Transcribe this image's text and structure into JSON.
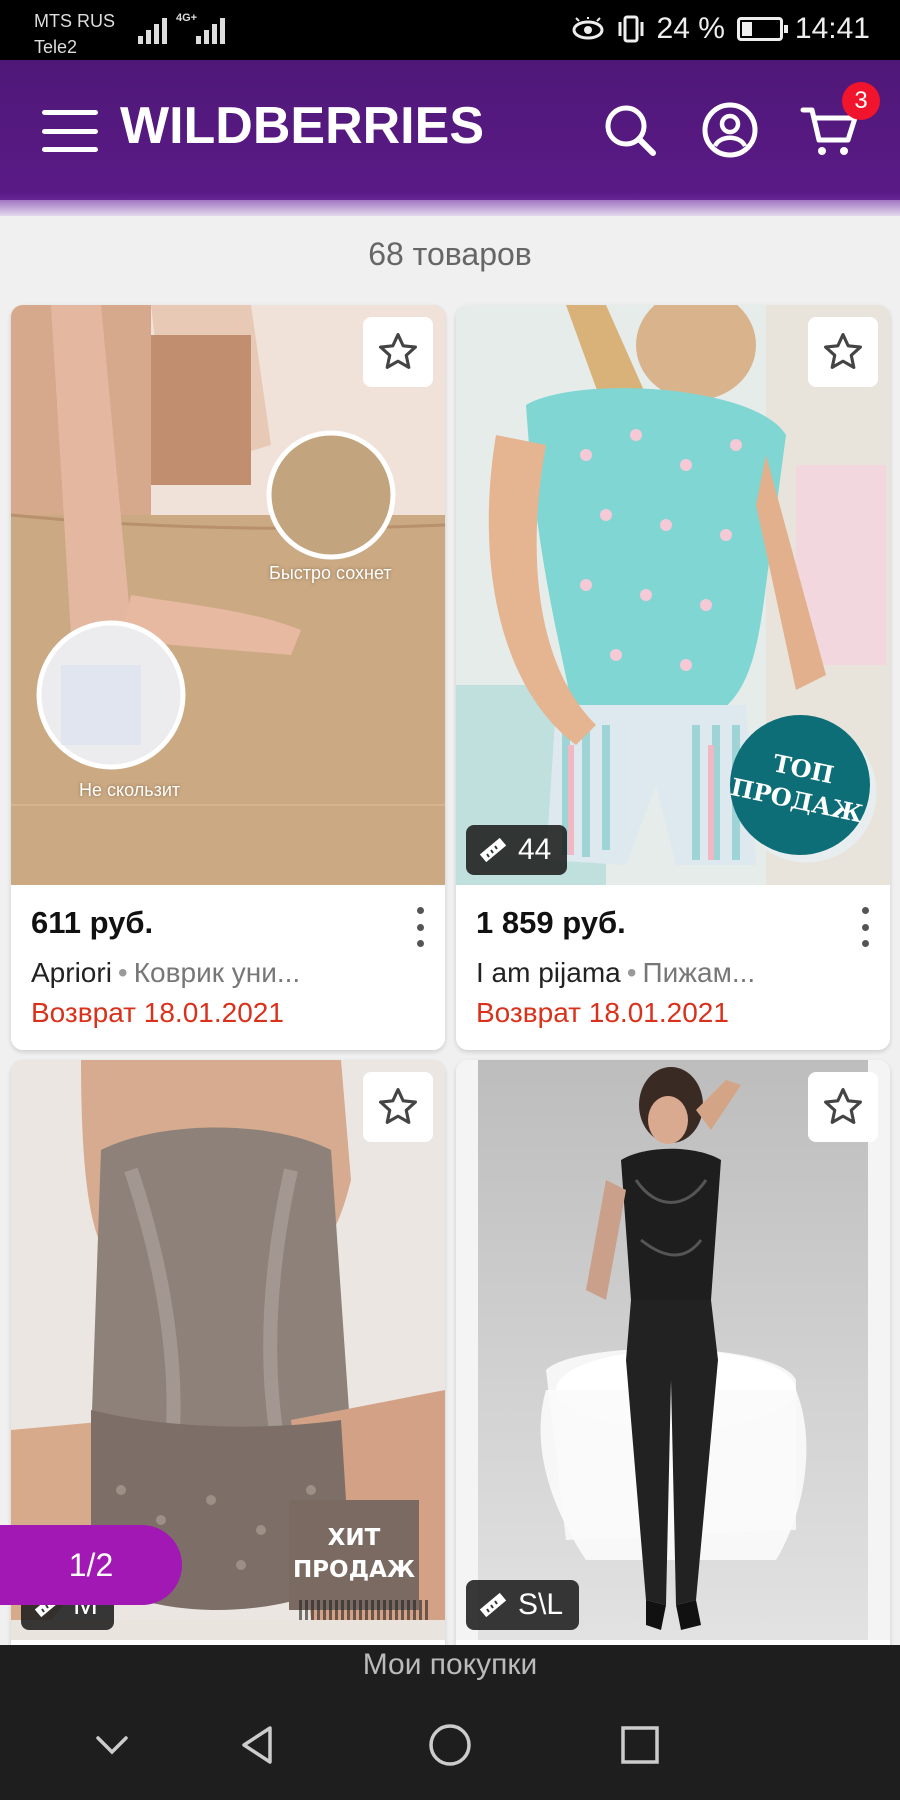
{
  "status_bar": {
    "carrier1": "MTS RUS",
    "carrier2": "Tele2",
    "network": "4G+",
    "battery": "24 %",
    "time": "14:41"
  },
  "header": {
    "logo": "WILDBERRIES",
    "cart_count": "3",
    "accent": "#5a1a86"
  },
  "results": {
    "count_label": "68 товаров"
  },
  "products": [
    {
      "price": "611 руб.",
      "brand": "Apriori",
      "name": "Коврик уни...",
      "return": "Возврат 18.01.2021",
      "photo_text1": "Быстро сохнет",
      "photo_text2": "Не скользит"
    },
    {
      "price": "1 859 руб.",
      "brand": "I am pijama",
      "name": "Пижам...",
      "return": "Возврат 18.01.2021",
      "size": "44",
      "promo": "ТОП ПРОДАЖ"
    },
    {
      "promo": "ХИТ ПРОДАЖ",
      "size": "M"
    },
    {
      "size": "S\\L"
    }
  ],
  "pager": {
    "label": "1/2"
  },
  "bottom": {
    "my_purchases": "Мои покупки"
  }
}
